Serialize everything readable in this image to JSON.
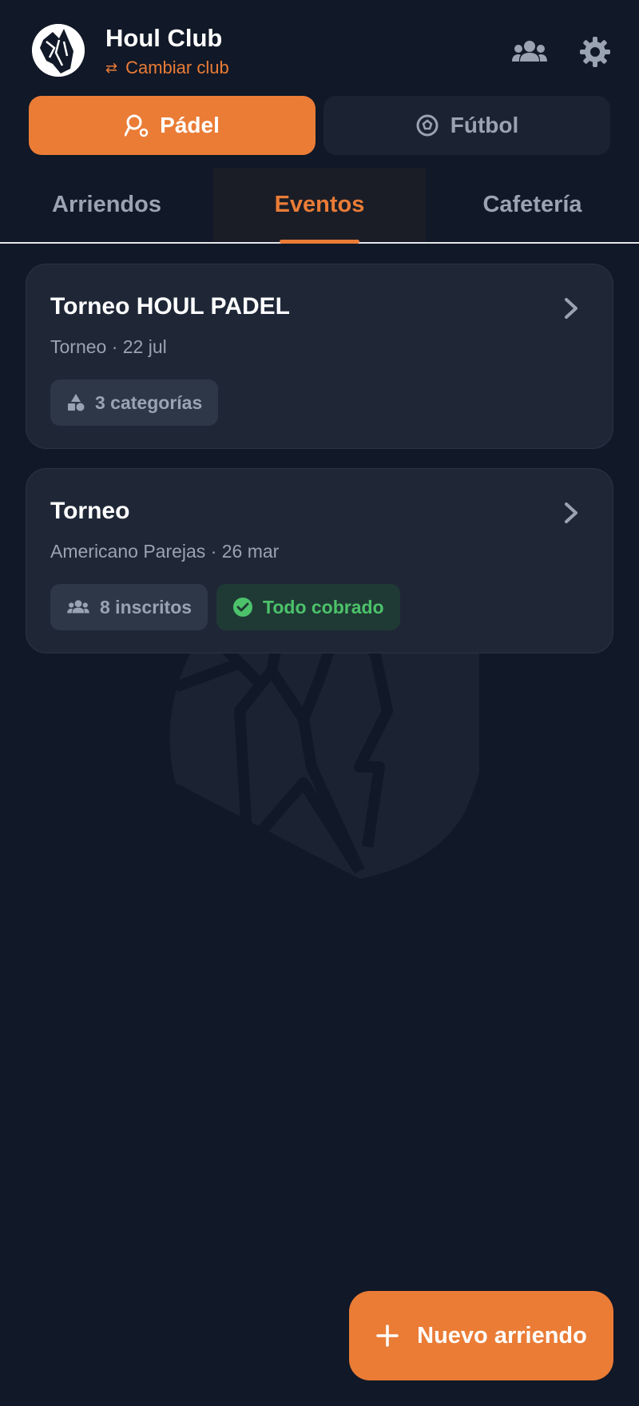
{
  "header": {
    "club_name": "Houl Club",
    "switch_label": "Cambiar club",
    "icons": [
      "wolf-logo",
      "swap-icon",
      "group-icon",
      "gear-icon"
    ]
  },
  "sports": [
    {
      "label": "Pádel",
      "icon": "padel-icon",
      "active": true
    },
    {
      "label": "Fútbol",
      "icon": "soccer-ball-icon",
      "active": false
    }
  ],
  "tabs": [
    {
      "label": "Arriendos",
      "active": false
    },
    {
      "label": "Eventos",
      "active": true
    },
    {
      "label": "Cafetería",
      "active": false
    }
  ],
  "events": [
    {
      "title": "Torneo HOUL PADEL",
      "subtitle": "Torneo · 22 jul",
      "chips": [
        {
          "label": "3 categorías",
          "icon": "category-icon",
          "style": "neutral"
        }
      ]
    },
    {
      "title": "Torneo",
      "subtitle": "Americano Parejas · 26 mar",
      "chips": [
        {
          "label": "8 inscritos",
          "icon": "group-icon",
          "style": "neutral"
        },
        {
          "label": "Todo cobrado",
          "icon": "check-circle-icon",
          "style": "success"
        }
      ]
    }
  ],
  "fab": {
    "label": "Nuevo arriendo",
    "icon": "plus-icon"
  },
  "colors": {
    "background": "#111827",
    "accent": "#ea7c36",
    "card": "#1f2737",
    "muted": "#9aa3b2",
    "success": "#4cc26a"
  }
}
